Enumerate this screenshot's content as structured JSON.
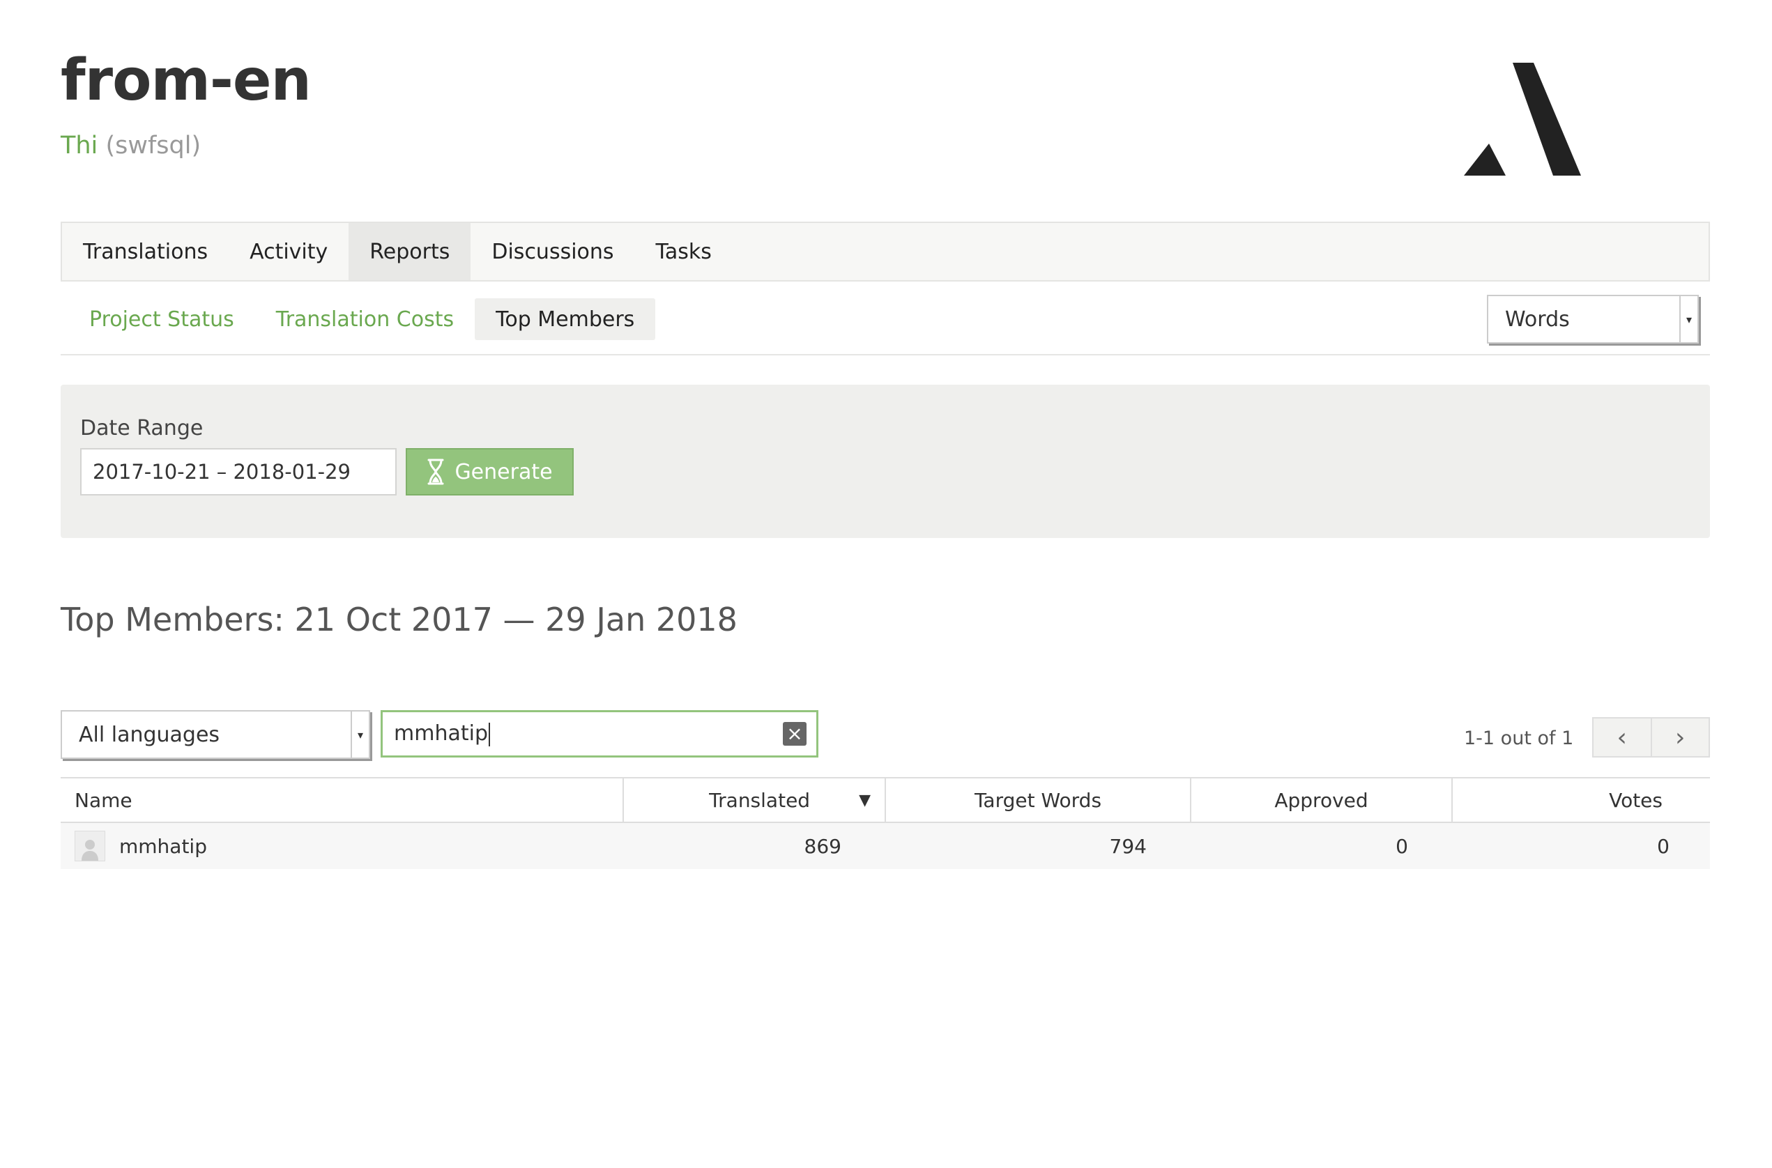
{
  "header": {
    "title": "from-en",
    "language": "Thi",
    "language_code": "(swfsql)",
    "logo": "crowdin-logo-icon"
  },
  "main_nav": [
    {
      "label": "Translations",
      "active": false
    },
    {
      "label": "Activity",
      "active": false
    },
    {
      "label": "Reports",
      "active": true
    },
    {
      "label": "Discussions",
      "active": false
    },
    {
      "label": "Tasks",
      "active": false
    }
  ],
  "sub_nav": [
    {
      "label": "Project Status",
      "active": false
    },
    {
      "label": "Translation Costs",
      "active": false
    },
    {
      "label": "Top Members",
      "active": true
    }
  ],
  "units_select": {
    "value": "Words"
  },
  "filter": {
    "date_range_label": "Date Range",
    "date_range_value": "2017-10-21 – 2018-01-29",
    "generate_label": "Generate"
  },
  "report": {
    "title": "Top Members: 21 Oct 2017 — 29 Jan 2018"
  },
  "language_filter": {
    "value": "All languages"
  },
  "search": {
    "value": "mmhatip"
  },
  "pagination": {
    "info": "1-1 out of 1"
  },
  "table": {
    "columns": [
      "Name",
      "Translated",
      "Target Words",
      "Approved",
      "Votes"
    ],
    "sorted_by": "Translated",
    "rows": [
      {
        "name": "mmhatip",
        "translated": "869",
        "target_words": "794",
        "approved": "0",
        "votes": "0"
      }
    ]
  },
  "colors": {
    "accent_green": "#6aa84f",
    "button_green": "#93c47d"
  }
}
